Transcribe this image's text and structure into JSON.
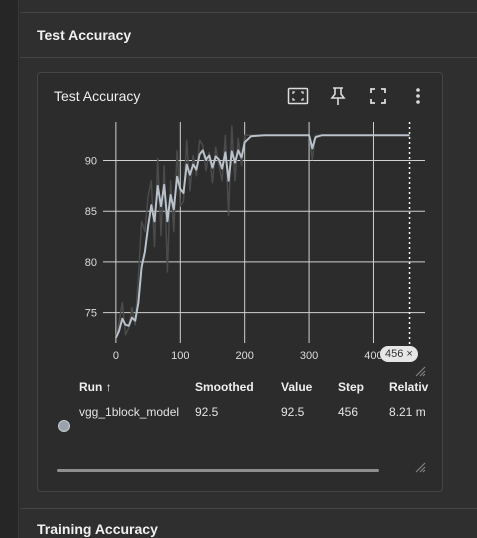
{
  "section": {
    "title": "Test Accuracy"
  },
  "card": {
    "title": "Test Accuracy",
    "icons": [
      "fit-domain-icon",
      "pin-icon",
      "fullscreen-icon",
      "more-vert-icon"
    ]
  },
  "step_badge": {
    "value": "456",
    "close": "×"
  },
  "table": {
    "headers": {
      "run": "Run ↑",
      "smoothed": "Smoothed",
      "value": "Value",
      "step": "Step",
      "relative": "Relativ"
    },
    "row": {
      "run": "vgg_1block_model",
      "smoothed": "92.5",
      "value": "92.5",
      "step": "456",
      "relative": "8.21 m"
    }
  },
  "next_section": {
    "title": "Training Accuracy"
  },
  "chart_data": {
    "type": "line",
    "title": "",
    "xlabel": "",
    "ylabel": "",
    "xlim": [
      -20,
      480
    ],
    "ylim": [
      72,
      93.8
    ],
    "x_ticks": [
      0,
      100,
      200,
      300,
      400
    ],
    "y_ticks": [
      75,
      80,
      85,
      90
    ],
    "grid": true,
    "cursor_step": 456,
    "series": [
      {
        "role": "raw",
        "color": "#4b4b4b",
        "x": [
          0,
          5,
          10,
          15,
          20,
          25,
          30,
          35,
          40,
          45,
          50,
          55,
          60,
          65,
          70,
          75,
          80,
          85,
          90,
          95,
          100,
          105,
          110,
          115,
          120,
          125,
          130,
          135,
          140,
          145,
          150,
          155,
          160,
          165,
          170,
          175,
          180,
          185,
          190,
          195,
          200,
          210,
          230,
          260,
          300,
          305,
          310,
          320,
          340,
          380,
          420,
          456
        ],
        "y": [
          72.5,
          74,
          76,
          72.8,
          73.5,
          75.5,
          73.8,
          78.5,
          84,
          83,
          86.5,
          88,
          81.5,
          90.2,
          82.6,
          89.5,
          79,
          88,
          83,
          91,
          85.5,
          86,
          92,
          87,
          90.5,
          88.5,
          92,
          91.5,
          89,
          90.8,
          87.8,
          91.3,
          89.6,
          88,
          92.5,
          84.6,
          93.4,
          88,
          92.2,
          89.5,
          92.5,
          92.5,
          92.5,
          92.5,
          92.5,
          90.1,
          92.5,
          92.5,
          92.5,
          92.5,
          92.5,
          92.5
        ]
      },
      {
        "role": "smoothed",
        "color": "#b9c1ca",
        "x": [
          0,
          5,
          10,
          15,
          20,
          25,
          30,
          35,
          40,
          45,
          50,
          55,
          60,
          65,
          70,
          75,
          80,
          85,
          90,
          95,
          100,
          105,
          110,
          115,
          120,
          125,
          130,
          135,
          140,
          145,
          150,
          155,
          160,
          165,
          170,
          175,
          180,
          185,
          190,
          195,
          200,
          210,
          230,
          260,
          300,
          305,
          310,
          320,
          340,
          380,
          420,
          456
        ],
        "y": [
          72.5,
          73.2,
          74.4,
          73.8,
          73.7,
          74.5,
          74.2,
          76,
          79.5,
          81,
          83.5,
          85.6,
          84,
          87.5,
          85.5,
          87.6,
          84,
          86.6,
          85.2,
          88.4,
          87.2,
          86.8,
          89.6,
          88.6,
          89.6,
          89.1,
          90.6,
          91,
          90.1,
          90.5,
          89.3,
          90.4,
          90.1,
          89.2,
          90.8,
          88,
          90.9,
          89.8,
          91,
          90.3,
          91.8,
          92.4,
          92.5,
          92.5,
          92.5,
          91.2,
          92.3,
          92.5,
          92.5,
          92.5,
          92.5,
          92.5
        ]
      }
    ]
  }
}
